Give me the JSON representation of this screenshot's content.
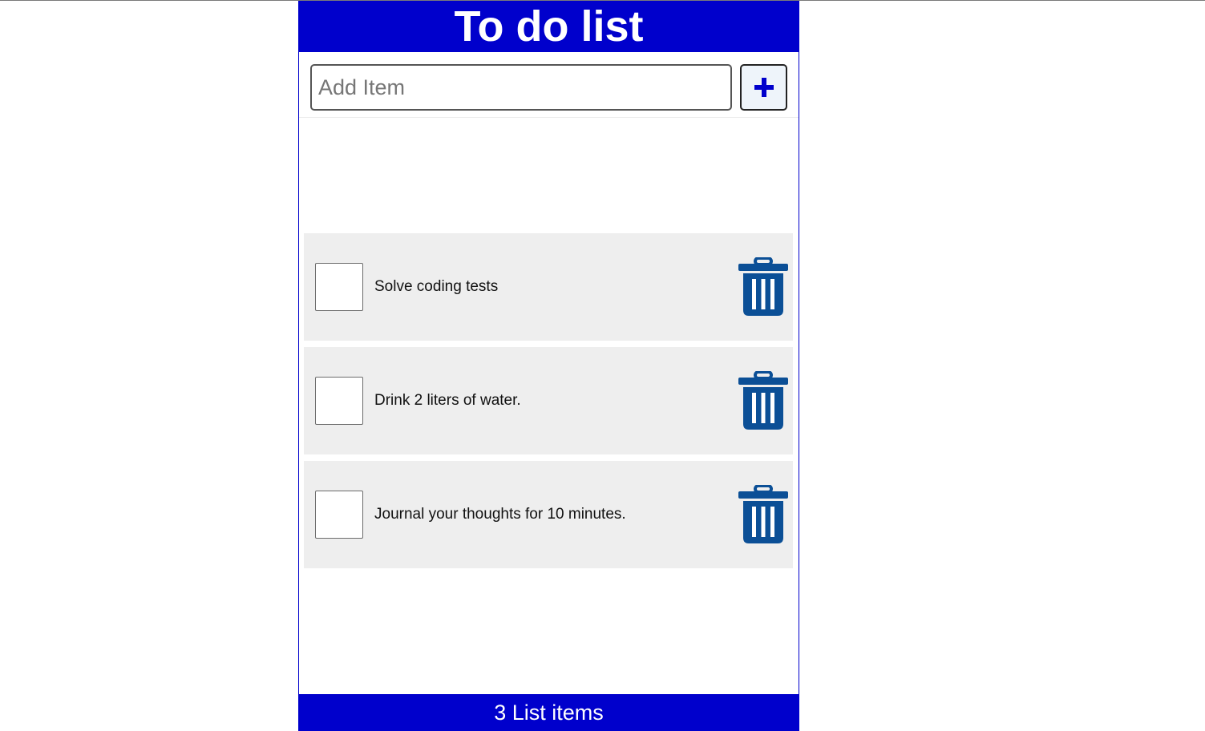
{
  "header": {
    "title": "To do list"
  },
  "add_form": {
    "placeholder": "Add Item",
    "value": "",
    "button_icon": "plus-icon"
  },
  "items": [
    {
      "label": "Solve coding tests",
      "checked": false,
      "delete_icon": "trash-icon"
    },
    {
      "label": "Drink 2 liters of water.",
      "checked": false,
      "delete_icon": "trash-icon"
    },
    {
      "label": "Journal your thoughts for 10 minutes.",
      "checked": false,
      "delete_icon": "trash-icon"
    }
  ],
  "footer": {
    "count_text": "3 List items"
  },
  "colors": {
    "primary": "#0000cc",
    "item_background": "#eeeeee",
    "trash_icon": "#0b4f96",
    "text": "#111111"
  }
}
